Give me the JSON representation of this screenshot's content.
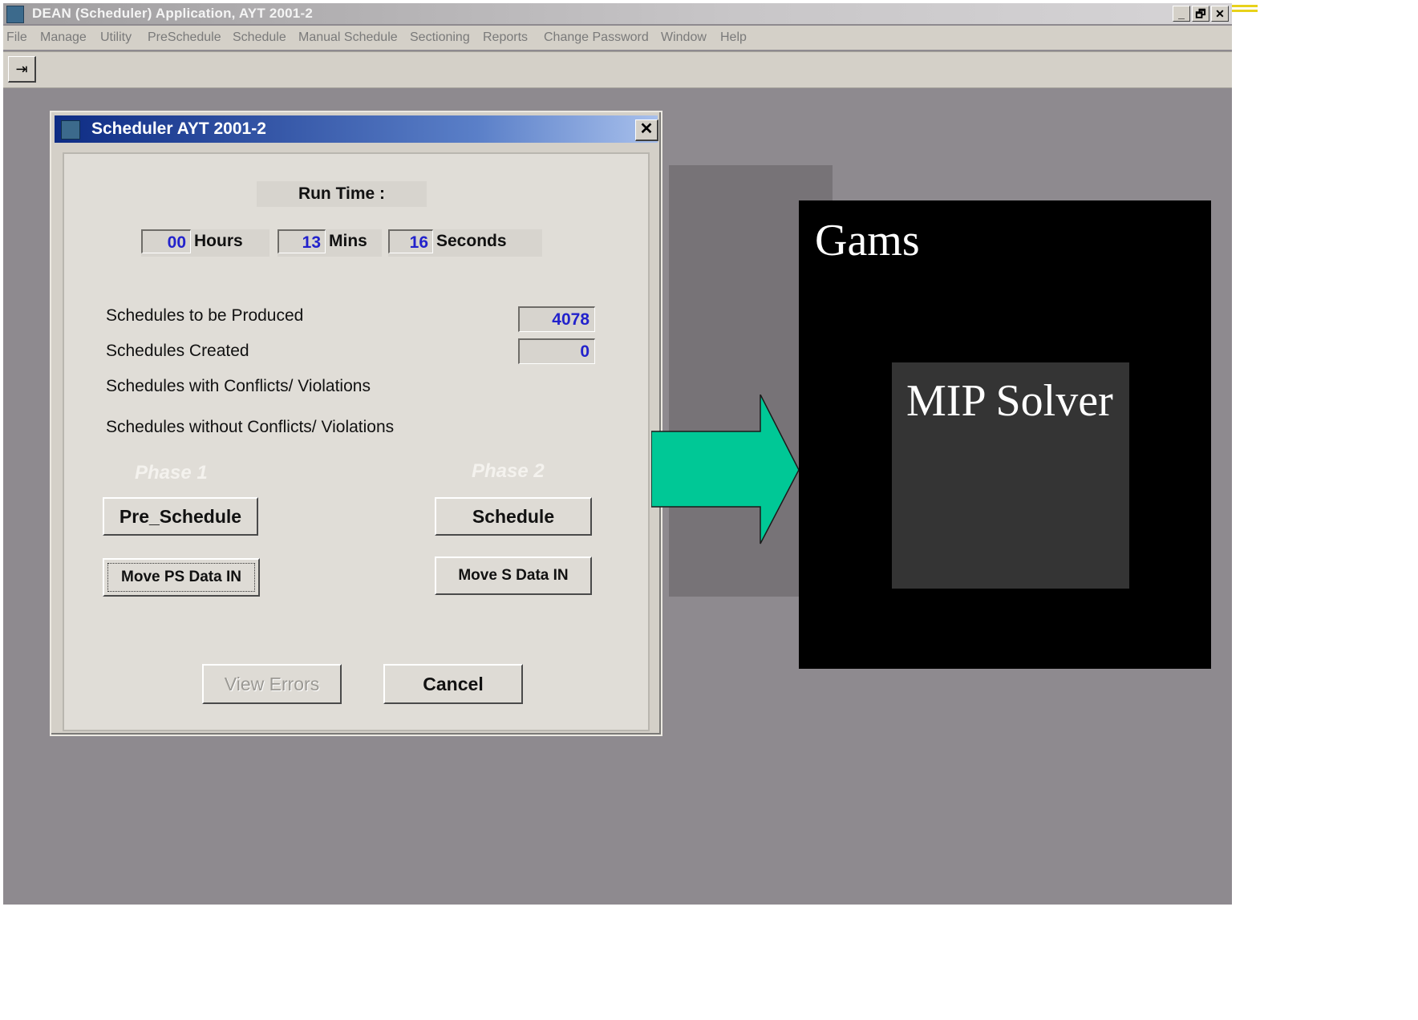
{
  "window": {
    "title": "DEAN (Scheduler) Application, AYT 2001-2",
    "controls": [
      "_",
      "🗗",
      "✕"
    ]
  },
  "menu": {
    "items": [
      "File",
      "Manage",
      "Utility",
      "PreSchedule",
      "Schedule",
      "Manual Schedule",
      "Sectioning",
      "Reports",
      "Change Password",
      "Window",
      "Help"
    ]
  },
  "toolbar": {
    "exit_glyph": "⇥"
  },
  "dialog": {
    "title": "Scheduler AYT 2001-2",
    "close_glyph": "✕",
    "run_time_label": "Run Time :",
    "hours_value": "00",
    "hours_label": "Hours",
    "mins_value": "13",
    "mins_label": "Mins",
    "seconds_value": "16",
    "seconds_label": "Seconds",
    "schedules_to_be_produced_label": "Schedules to be Produced",
    "schedules_to_be_produced_value": "4078",
    "schedules_created_label": "Schedules Created",
    "schedules_created_value": "0",
    "with_conflicts_label": "Schedules with Conflicts/ Violations",
    "without_conflicts_label": "Schedules without Conflicts/ Violations",
    "phase1_label": "Phase 1",
    "phase2_label": "Phase 2",
    "pre_schedule_button": "Pre_Schedule",
    "schedule_button": "Schedule",
    "move_ps_button": "Move PS Data IN",
    "move_s_button": "Move S Data IN",
    "view_errors_button": "View Errors",
    "cancel_button": "Cancel"
  },
  "overlay": {
    "gams_label": "Gams",
    "mip_label": "MIP Solver",
    "arrow_color": "#00c896"
  }
}
